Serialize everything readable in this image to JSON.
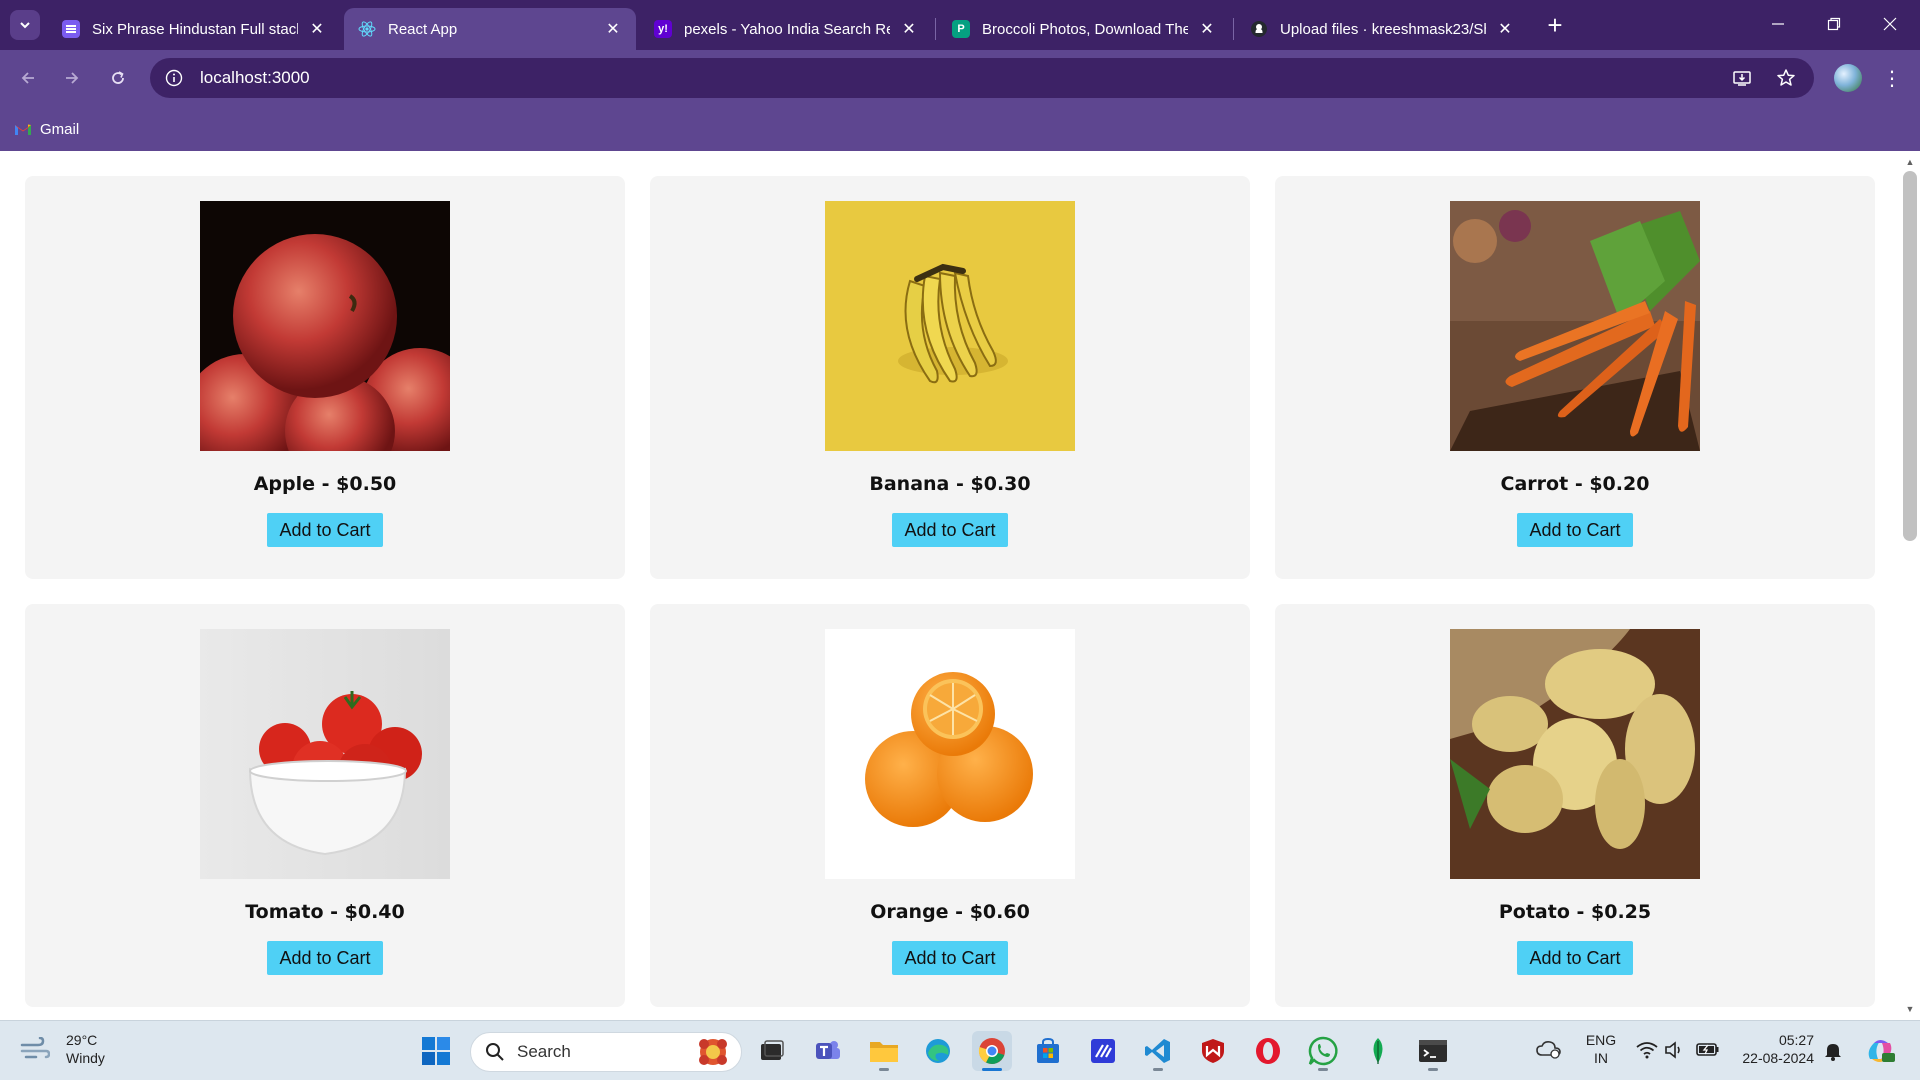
{
  "browser": {
    "tabs": [
      {
        "title": "Six Phrase Hindustan Full stack",
        "favicon": "course-icon",
        "active": false
      },
      {
        "title": "React App",
        "favicon": "react-icon",
        "active": true
      },
      {
        "title": "pexels - Yahoo India Search Res",
        "favicon": "yahoo-icon",
        "active": false
      },
      {
        "title": "Broccoli Photos, Download The",
        "favicon": "pexels-icon",
        "active": false
      },
      {
        "title": "Upload files · kreeshmask23/Sh",
        "favicon": "github-icon",
        "active": false
      }
    ],
    "url": "localhost:3000",
    "bookmarks": [
      {
        "label": "Gmail",
        "icon": "gmail-icon"
      }
    ]
  },
  "products": [
    {
      "name": "Apple",
      "price": "$0.50",
      "button": "Add to Cart",
      "image": "apples"
    },
    {
      "name": "Banana",
      "price": "$0.30",
      "button": "Add to Cart",
      "image": "bananas"
    },
    {
      "name": "Carrot",
      "price": "$0.20",
      "button": "Add to Cart",
      "image": "carrots"
    },
    {
      "name": "Tomato",
      "price": "$0.40",
      "button": "Add to Cart",
      "image": "tomatoes"
    },
    {
      "name": "Orange",
      "price": "$0.60",
      "button": "Add to Cart",
      "image": "oranges"
    },
    {
      "name": "Potato",
      "price": "$0.25",
      "button": "Add to Cart",
      "image": "potatoes"
    }
  ],
  "taskbar": {
    "weather": {
      "temp": "29°C",
      "condition": "Windy"
    },
    "search_placeholder": "Search",
    "language": {
      "line1": "ENG",
      "line2": "IN"
    },
    "time": "05:27",
    "date": "22-08-2024"
  },
  "colors": {
    "tab_strip": "#3d2266",
    "toolbar": "#5e4690",
    "card_bg": "#f4f4f4",
    "button_bg": "#4fd0f5"
  }
}
